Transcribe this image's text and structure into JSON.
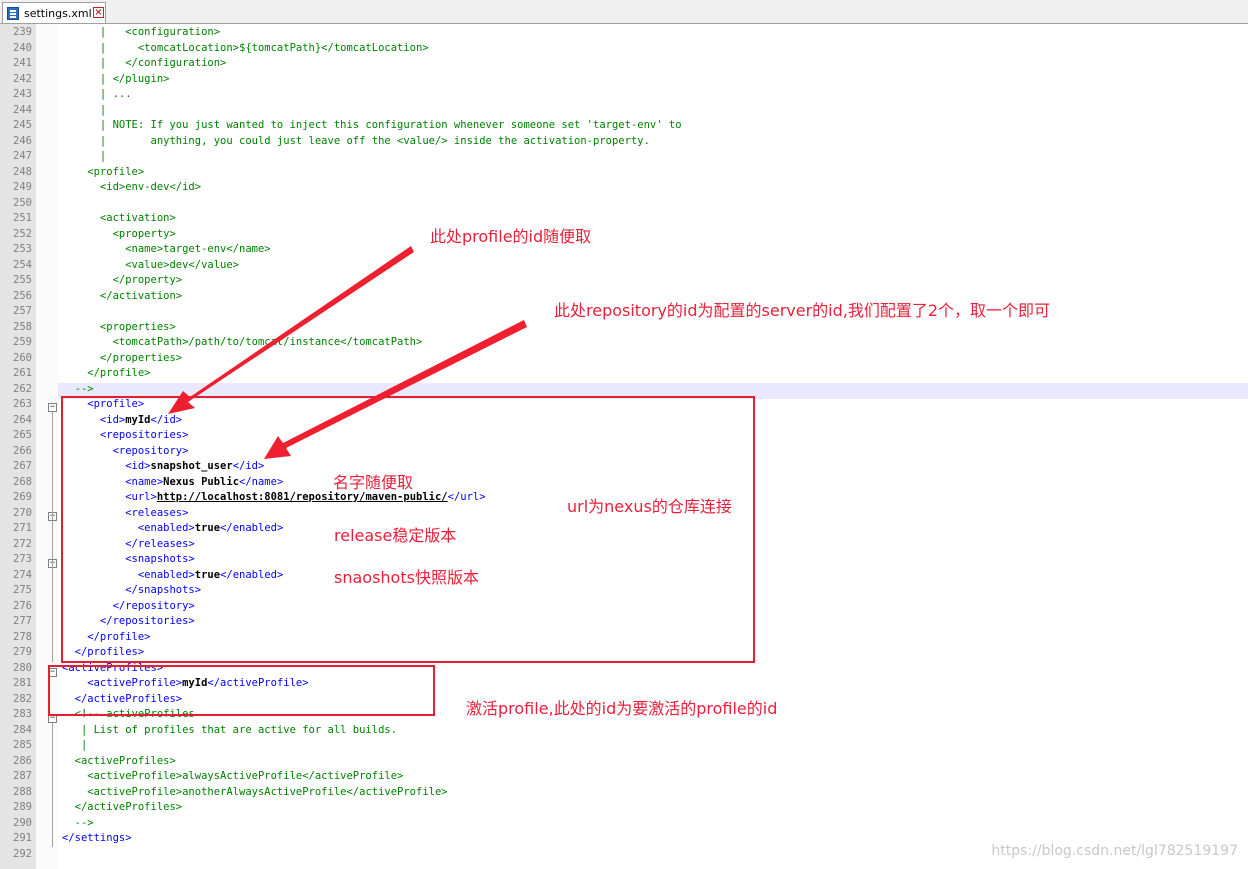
{
  "tab": {
    "filename": "settings.xml"
  },
  "lines": [
    {
      "n": "239",
      "segs": [
        [
          "c",
          "      |   "
        ],
        [
          "c",
          "<configuration>"
        ]
      ]
    },
    {
      "n": "240",
      "segs": [
        [
          "c",
          "      |     "
        ],
        [
          "c",
          "<tomcatLocation>${tomcatPath}</tomcatLocation>"
        ]
      ]
    },
    {
      "n": "241",
      "segs": [
        [
          "c",
          "      |   "
        ],
        [
          "c",
          "</configuration>"
        ]
      ]
    },
    {
      "n": "242",
      "segs": [
        [
          "c",
          "      | "
        ],
        [
          "c",
          "</plugin>"
        ]
      ]
    },
    {
      "n": "243",
      "segs": [
        [
          "c",
          "      | ..."
        ]
      ]
    },
    {
      "n": "244",
      "segs": [
        [
          "c",
          "      |"
        ]
      ]
    },
    {
      "n": "245",
      "segs": [
        [
          "c",
          "      | NOTE: If you just wanted to inject this configuration whenever someone set 'target-env' to"
        ]
      ]
    },
    {
      "n": "246",
      "segs": [
        [
          "c",
          "      |       anything, you could just leave off the <value/> inside the activation-property."
        ]
      ]
    },
    {
      "n": "247",
      "segs": [
        [
          "c",
          "      |"
        ]
      ]
    },
    {
      "n": "248",
      "segs": [
        [
          "c",
          "    <profile>"
        ]
      ]
    },
    {
      "n": "249",
      "segs": [
        [
          "c",
          "      <id>env-dev</id>"
        ]
      ]
    },
    {
      "n": "250",
      "segs": [
        [
          "c",
          ""
        ]
      ]
    },
    {
      "n": "251",
      "segs": [
        [
          "c",
          "      <activation>"
        ]
      ]
    },
    {
      "n": "252",
      "segs": [
        [
          "c",
          "        <property>"
        ]
      ]
    },
    {
      "n": "253",
      "segs": [
        [
          "c",
          "          <name>target-env</name>"
        ]
      ]
    },
    {
      "n": "254",
      "segs": [
        [
          "c",
          "          <value>dev</value>"
        ]
      ]
    },
    {
      "n": "255",
      "segs": [
        [
          "c",
          "        </property>"
        ]
      ]
    },
    {
      "n": "256",
      "segs": [
        [
          "c",
          "      </activation>"
        ]
      ]
    },
    {
      "n": "257",
      "segs": [
        [
          "c",
          ""
        ]
      ]
    },
    {
      "n": "258",
      "segs": [
        [
          "c",
          "      <properties>"
        ]
      ]
    },
    {
      "n": "259",
      "segs": [
        [
          "c",
          "        <tomcatPath>/path/to/tomcat/instance</tomcatPath>"
        ]
      ]
    },
    {
      "n": "260",
      "segs": [
        [
          "c",
          "      </properties>"
        ]
      ]
    },
    {
      "n": "261",
      "segs": [
        [
          "c",
          "    </profile>"
        ]
      ]
    },
    {
      "n": "262",
      "segs": [
        [
          "c",
          "  -->"
        ]
      ]
    },
    {
      "n": "263",
      "segs": [
        [
          "t",
          "    <profile>"
        ]
      ]
    },
    {
      "n": "264",
      "segs": [
        [
          "t",
          "      <id>"
        ],
        [
          "v",
          "myId"
        ],
        [
          "t",
          "</id>"
        ]
      ]
    },
    {
      "n": "265",
      "segs": [
        [
          "t",
          "      <repositories>"
        ]
      ]
    },
    {
      "n": "266",
      "segs": [
        [
          "t",
          "        <repository>"
        ]
      ]
    },
    {
      "n": "267",
      "segs": [
        [
          "t",
          "          <id>"
        ],
        [
          "v",
          "snapshot_user"
        ],
        [
          "t",
          "</id>"
        ]
      ]
    },
    {
      "n": "268",
      "segs": [
        [
          "t",
          "          <name>"
        ],
        [
          "v",
          "Nexus Public"
        ],
        [
          "t",
          "</name>"
        ]
      ]
    },
    {
      "n": "269",
      "segs": [
        [
          "t",
          "          <url>"
        ],
        [
          "u",
          "http://localhost:8081/repository/maven-public/"
        ],
        [
          "t",
          "</url>"
        ]
      ]
    },
    {
      "n": "270",
      "segs": [
        [
          "t",
          "          <releases>"
        ]
      ]
    },
    {
      "n": "271",
      "segs": [
        [
          "t",
          "            <enabled>"
        ],
        [
          "v",
          "true"
        ],
        [
          "t",
          "</enabled>"
        ]
      ]
    },
    {
      "n": "272",
      "segs": [
        [
          "t",
          "          </releases>"
        ]
      ]
    },
    {
      "n": "273",
      "segs": [
        [
          "t",
          "          <snapshots>"
        ]
      ]
    },
    {
      "n": "274",
      "segs": [
        [
          "t",
          "            <enabled>"
        ],
        [
          "v",
          "true"
        ],
        [
          "t",
          "</enabled>"
        ]
      ]
    },
    {
      "n": "275",
      "segs": [
        [
          "t",
          "          </snapshots>"
        ]
      ]
    },
    {
      "n": "276",
      "segs": [
        [
          "t",
          "        </repository>"
        ]
      ]
    },
    {
      "n": "277",
      "segs": [
        [
          "t",
          "      </repositories>"
        ]
      ]
    },
    {
      "n": "278",
      "segs": [
        [
          "t",
          "    </profile>"
        ]
      ]
    },
    {
      "n": "279",
      "segs": [
        [
          "t",
          "  </profiles>"
        ]
      ]
    },
    {
      "n": "280",
      "segs": [
        [
          "t",
          "<activeProfiles>"
        ]
      ]
    },
    {
      "n": "281",
      "segs": [
        [
          "t",
          "    <activeProfile>"
        ],
        [
          "v",
          "myId"
        ],
        [
          "t",
          "</activeProfile>"
        ]
      ]
    },
    {
      "n": "282",
      "segs": [
        [
          "t",
          "  </activeProfiles>"
        ]
      ]
    },
    {
      "n": "283",
      "segs": [
        [
          "c",
          "  <!-- activeProfiles"
        ]
      ]
    },
    {
      "n": "284",
      "segs": [
        [
          "c",
          "   | List of profiles that are active for all builds."
        ]
      ]
    },
    {
      "n": "285",
      "segs": [
        [
          "c",
          "   |"
        ]
      ]
    },
    {
      "n": "286",
      "segs": [
        [
          "c",
          "  <activeProfiles>"
        ]
      ]
    },
    {
      "n": "287",
      "segs": [
        [
          "c",
          "    <activeProfile>alwaysActiveProfile</activeProfile>"
        ]
      ]
    },
    {
      "n": "288",
      "segs": [
        [
          "c",
          "    <activeProfile>anotherAlwaysActiveProfile</activeProfile>"
        ]
      ]
    },
    {
      "n": "289",
      "segs": [
        [
          "c",
          "  </activeProfiles>"
        ]
      ]
    },
    {
      "n": "290",
      "segs": [
        [
          "c",
          "  -->"
        ]
      ]
    },
    {
      "n": "291",
      "segs": [
        [
          "t",
          "</settings>"
        ]
      ]
    },
    {
      "n": "292",
      "segs": [
        [
          "c",
          ""
        ]
      ]
    }
  ],
  "annotations": {
    "profile_id": "此处profile的id随便取",
    "repository_id": "此处repository的id为配置的server的id,我们配置了2个，取一个即可",
    "name": "名字随便取",
    "url": "url为nexus的仓库连接",
    "release": "release稳定版本",
    "snapshots": "snaoshots快照版本",
    "active": "激活profile,此处的id为要激活的profile的id"
  },
  "colors": {
    "annotation": "#e8213a",
    "tag": "#0000ff",
    "comment": "#008000",
    "current_line": "#e8e8ff"
  },
  "watermark": "https://blog.csdn.net/lgl782519197"
}
